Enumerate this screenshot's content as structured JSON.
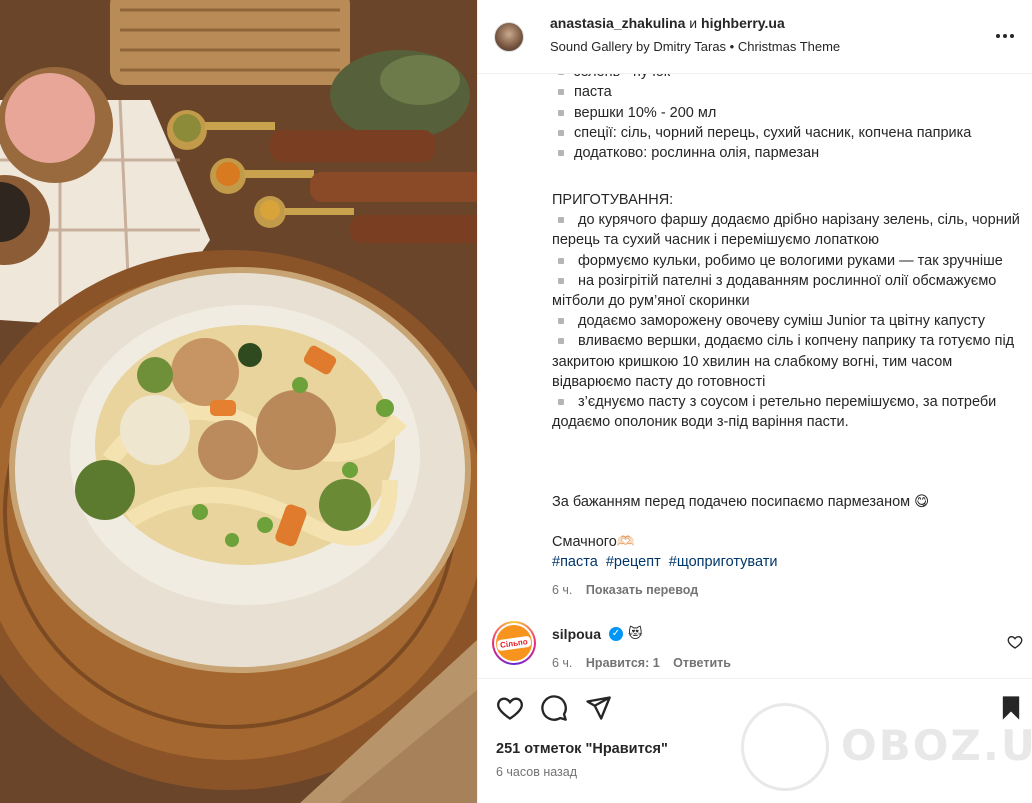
{
  "header": {
    "user1": "anastasia_zhakulina",
    "conjunction": "и",
    "user2": "highberry.ua",
    "music": "Sound Gallery by Dmitry Taras • Christmas Theme"
  },
  "caption": {
    "ingredients": [
      "зелень - пучок",
      "паста",
      "вершки 10% - 200 мл",
      "спеції: сіль, чорний перець, сухий часник, копчена паприка",
      "додатково: рослинна олія, пармезан"
    ],
    "prep_title": "ПРИГОТУВАННЯ:",
    "steps": [
      "до курячого фаршу додаємо дрібно нарізану зелень, сіль, чорний перець та сухий часник і перемішуємо лопаткою",
      "формуємо кульки, робимо це вологими руками — так зручніше",
      "на розігрітій пателні з додаванням рослинної олії обсмажуємо мітболи до рум’яної скоринки",
      "додаємо заморожену овочеву суміш Junior та цвітну капусту",
      "вливаємо вершки, додаємо сіль і копчену паприку та готуємо під закритою кришкою 10 хвилин на слабкому вогні, тим часом відварюємо пасту до готовності",
      "з’єднуємо пасту з соусом і ретельно перемішуємо, за потреби додаємо ополоник води з-під варіння пасти."
    ],
    "serving": "За бажанням перед подачею посипаємо пармезаном 😋",
    "bon_appetit": "Смачного🫶🏻",
    "hashtags": [
      "#паста",
      "#рецепт",
      "#щоприготувати"
    ],
    "age": "6 ч.",
    "translate": "Показать перевод"
  },
  "comment": {
    "user": "silpoua",
    "verified": "✓",
    "text": "😻",
    "logo_text": "Сільпо",
    "age": "6 ч.",
    "likes": "Нравится: 1",
    "reply": "Ответить"
  },
  "footer": {
    "likes": "251 отметок \"Нравится\"",
    "time": "6 часов назад"
  },
  "watermark": "OBOZ.UA",
  "icons": {
    "heart": "heart-icon",
    "comment": "comment-icon",
    "share": "share-icon",
    "save": "bookmark-icon",
    "more": "more-options-icon"
  }
}
